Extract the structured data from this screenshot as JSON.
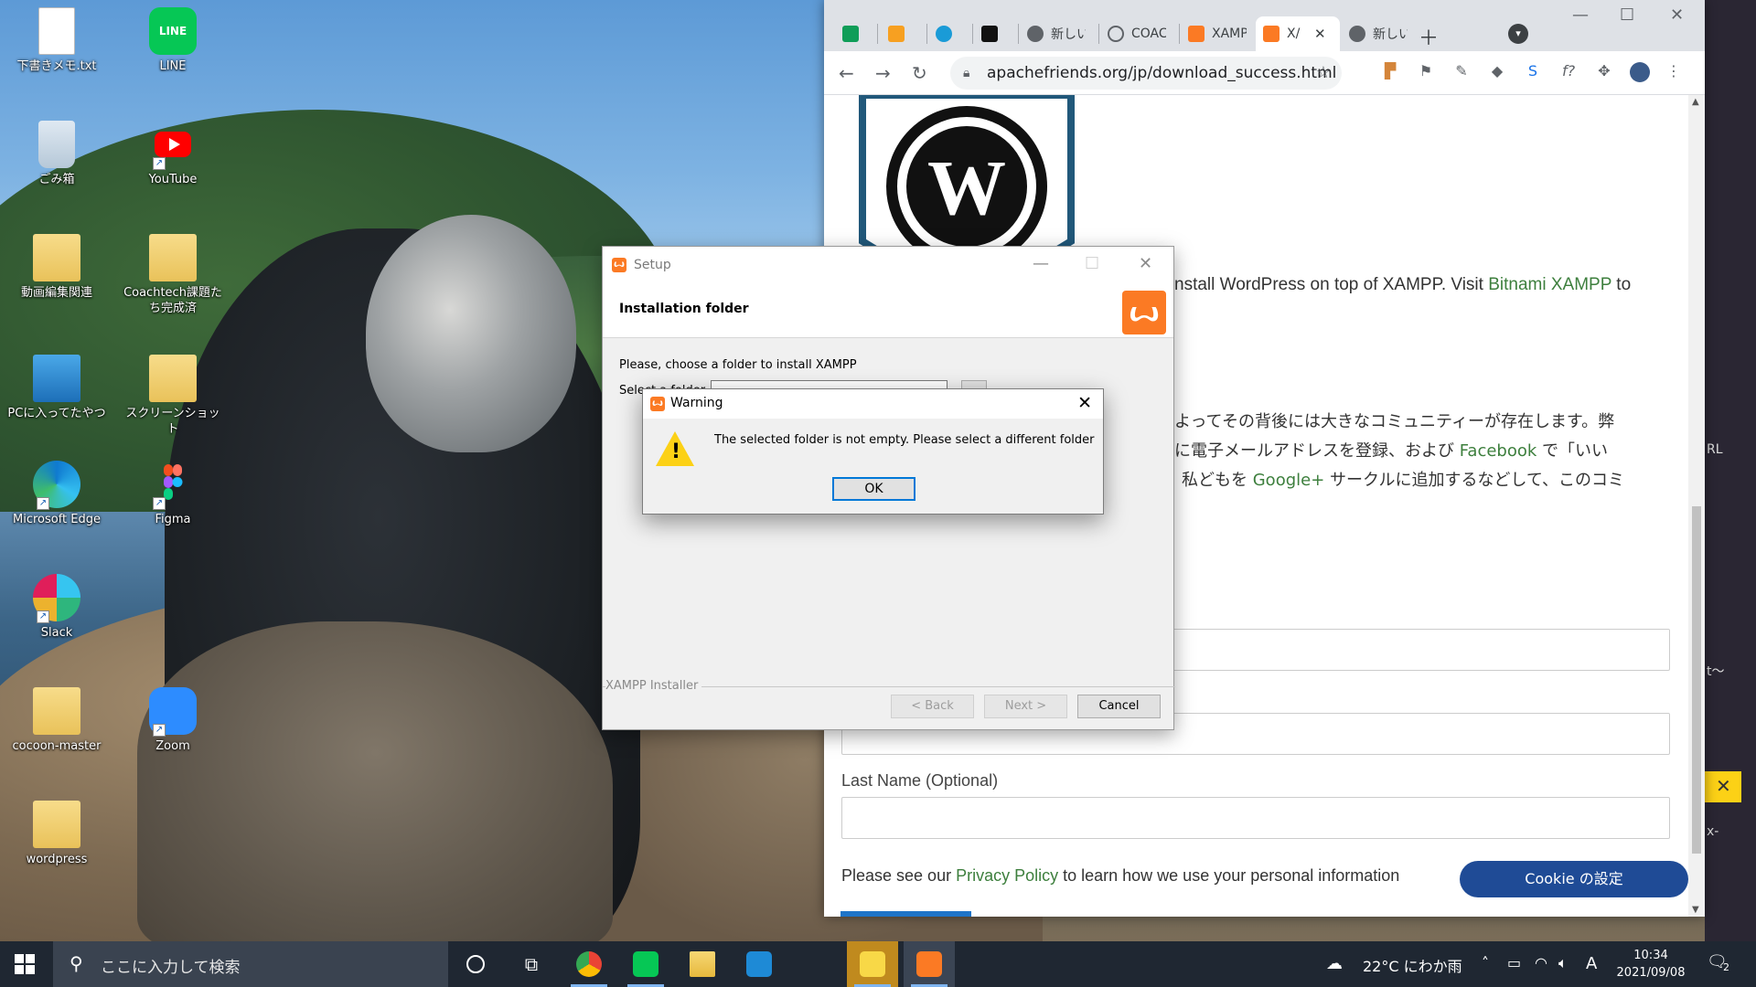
{
  "desktop": {
    "icons": [
      {
        "label": "下書きメモ.txt",
        "icon": "text-file-icon"
      },
      {
        "label": "LINE",
        "icon": "line-icon"
      },
      {
        "label": "ごみ箱",
        "icon": "recycle-bin-icon"
      },
      {
        "label": "YouTube",
        "icon": "youtube-icon"
      },
      {
        "label": "動画編集関連",
        "icon": "folder-icon"
      },
      {
        "label": "Coachtech課題たち完成済",
        "icon": "folder-icon"
      },
      {
        "label": "PCに入ってたやつ",
        "icon": "screen-icon"
      },
      {
        "label": "スクリーンショット",
        "icon": "folder-icon"
      },
      {
        "label": "Microsoft Edge",
        "icon": "edge-icon"
      },
      {
        "label": "Figma",
        "icon": "figma-icon"
      },
      {
        "label": "Slack",
        "icon": "slack-icon"
      },
      {
        "label": "cocoon-master",
        "icon": "folder-icon"
      },
      {
        "label": "Zoom",
        "icon": "zoom-icon"
      },
      {
        "label": "wordpress",
        "icon": "folder-icon"
      }
    ],
    "side_fragments": [
      "RL",
      "t〜",
      "x-"
    ]
  },
  "browser": {
    "tabs": [
      {
        "label": "",
        "icon": "sheets-icon"
      },
      {
        "label": "",
        "icon": "orange-box-icon"
      },
      {
        "label": "",
        "icon": "blue-app-icon"
      },
      {
        "label": "",
        "icon": "black-app-icon"
      },
      {
        "label": "新しい",
        "icon": "chrome-icon"
      },
      {
        "label": "COAC",
        "icon": "loading-icon"
      },
      {
        "label": "XAMP",
        "icon": "xampp-icon"
      },
      {
        "label": "X/",
        "icon": "xampp-icon",
        "active": true
      },
      {
        "label": "新しい",
        "icon": "chrome-icon"
      }
    ],
    "url": "apachefriends.org/jp/download_success.html",
    "page": {
      "line1_prefix": "nstall WordPress on top of XAMPP. Visit ",
      "line1_link": "Bitnami XAMPP",
      "line1_suffix": " to",
      "jp1": "よってその背後には大きなコミュニティーが存在します。弊",
      "jp2_prefix": "に電子メールアドレスを登録、および ",
      "jp2_link": "Facebook",
      "jp2_suffix": " で「いい",
      "jp3_prefix": "私どもを ",
      "jp3_link": "Google+",
      "jp3_suffix": " サークルに追加するなどして、このコミ",
      "last_name_label": "Last Name (Optional)",
      "privacy_prefix": "Please see our ",
      "privacy_link": "Privacy Policy",
      "privacy_suffix": " to learn how we use your personal information",
      "cookie_button": "Cookie の設定"
    }
  },
  "setup": {
    "title": "Setup",
    "heading": "Installation folder",
    "prompt": "Please, choose a folder to install XAMPP",
    "select_label": "Select a folder",
    "installer_label": "XAMPP Installer",
    "back": "< Back",
    "next": "Next >",
    "cancel": "Cancel"
  },
  "warning": {
    "title": "Warning",
    "message": "The selected folder is not empty. Please select a different folder",
    "ok": "OK"
  },
  "taskbar": {
    "search_placeholder": "ここに入力して検索",
    "weather": "22°C にわか雨",
    "ime": "A",
    "time": "10:34",
    "date": "2021/09/08",
    "notifications": "2"
  },
  "colors": {
    "xampp_orange": "#fb7a24",
    "link_green": "#3d7f3d",
    "cookie_blue": "#1f4b96",
    "warning_yellow": "#fcd116",
    "ok_focus": "#0078d7"
  }
}
